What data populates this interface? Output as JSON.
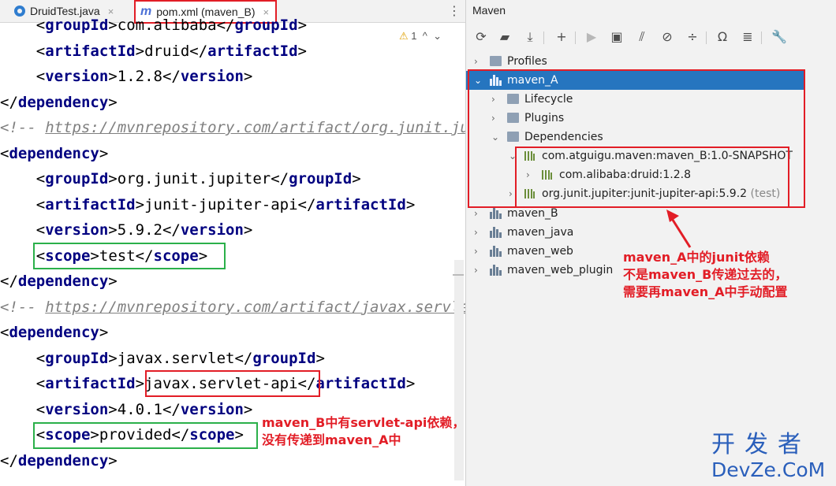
{
  "editor": {
    "tabs": [
      {
        "label": "DruidTest.java",
        "icon": "java-class-icon"
      },
      {
        "label": "pom.xml (maven_B)",
        "icon": "maven-m-icon"
      }
    ],
    "warnings": "1",
    "lines": [
      {
        "indent": "    ",
        "tag": "groupId",
        "value": "com.alibaba"
      },
      {
        "indent": "    ",
        "tag": "artifactId",
        "value": "druid"
      },
      {
        "indent": "    ",
        "tag": "version",
        "value": "1.2.8"
      },
      {
        "close_tag": "dependency"
      },
      {
        "comment_prefix": "<!-- ",
        "url": "https://mvnrepository.com/artifact/org.junit.jupiter/junit-jupiter-api"
      },
      {
        "open_tag": "dependency"
      },
      {
        "indent": "    ",
        "tag": "groupId",
        "value": "org.junit.jupiter"
      },
      {
        "indent": "    ",
        "tag": "artifactId",
        "value": "junit-jupiter-api"
      },
      {
        "indent": "    ",
        "tag": "version",
        "value": "5.9.2"
      },
      {
        "indent": "    ",
        "tag": "scope",
        "value": "test"
      },
      {
        "close_tag": "dependency"
      },
      {
        "comment_prefix": "<!-- ",
        "url": "https://mvnrepository.com/artifact/javax.servlet/javax.servlet-api"
      },
      {
        "open_tag": "dependency"
      },
      {
        "indent": "    ",
        "tag": "groupId",
        "value": "javax.servlet"
      },
      {
        "indent": "    ",
        "tag": "artifactId",
        "value": "javax.servlet-api"
      },
      {
        "indent": "    ",
        "tag": "version",
        "value": "4.0.1"
      },
      {
        "indent": "    ",
        "tag": "scope",
        "value": "provided"
      },
      {
        "close_tag": "dependency"
      }
    ],
    "annotation": [
      "maven_B中有servlet-api依赖，",
      "没有传递到maven_A中"
    ]
  },
  "maven": {
    "title": "Maven",
    "toolbar_icons": [
      "reload-icon",
      "generate-sources-icon",
      "download-icon",
      "add-icon",
      "run-icon",
      "execute-goal-icon",
      "toggle-offline-icon",
      "skip-tests-icon",
      "collapse-icon",
      "show-dependencies-icon",
      "show-diagram-icon",
      "settings-wrench-icon"
    ],
    "tree": [
      {
        "label": "Profiles",
        "level": 0,
        "expanded": false,
        "icon": "folder"
      },
      {
        "label": "maven_A",
        "level": 0,
        "expanded": true,
        "icon": "module",
        "selected": true
      },
      {
        "label": "Lifecycle",
        "level": 1,
        "expanded": false,
        "icon": "folder"
      },
      {
        "label": "Plugins",
        "level": 1,
        "expanded": false,
        "icon": "folder"
      },
      {
        "label": "Dependencies",
        "level": 1,
        "expanded": true,
        "icon": "folder"
      },
      {
        "label": "com.atguigu.maven:maven_B:1.0-SNAPSHOT",
        "level": 2,
        "expanded": true,
        "icon": "deps"
      },
      {
        "label": "com.alibaba:druid:1.2.8",
        "level": 3,
        "expanded": false,
        "icon": "deps"
      },
      {
        "label": "org.junit.jupiter:junit-jupiter-api:5.9.2",
        "suffix": "(test)",
        "level": 2,
        "expanded": false,
        "icon": "deps"
      },
      {
        "label": "maven_B",
        "level": 0,
        "expanded": false,
        "icon": "module"
      },
      {
        "label": "maven_java",
        "level": 0,
        "expanded": false,
        "icon": "module"
      },
      {
        "label": "maven_web",
        "level": 0,
        "expanded": false,
        "icon": "module"
      },
      {
        "label": "maven_web_plugin",
        "level": 0,
        "expanded": false,
        "icon": "module"
      }
    ],
    "annotation": [
      "maven_A中的junit依赖",
      "不是maven_B传递过去的，",
      "需要再maven_A中手动配置"
    ]
  },
  "watermark": {
    "cn": "开发者",
    "en": "DevZe.CoM"
  },
  "colors": {
    "highlight_red": "#e21d26",
    "highlight_green": "#2bb04a",
    "selection": "#2675bf",
    "xml_tag": "#000080"
  }
}
